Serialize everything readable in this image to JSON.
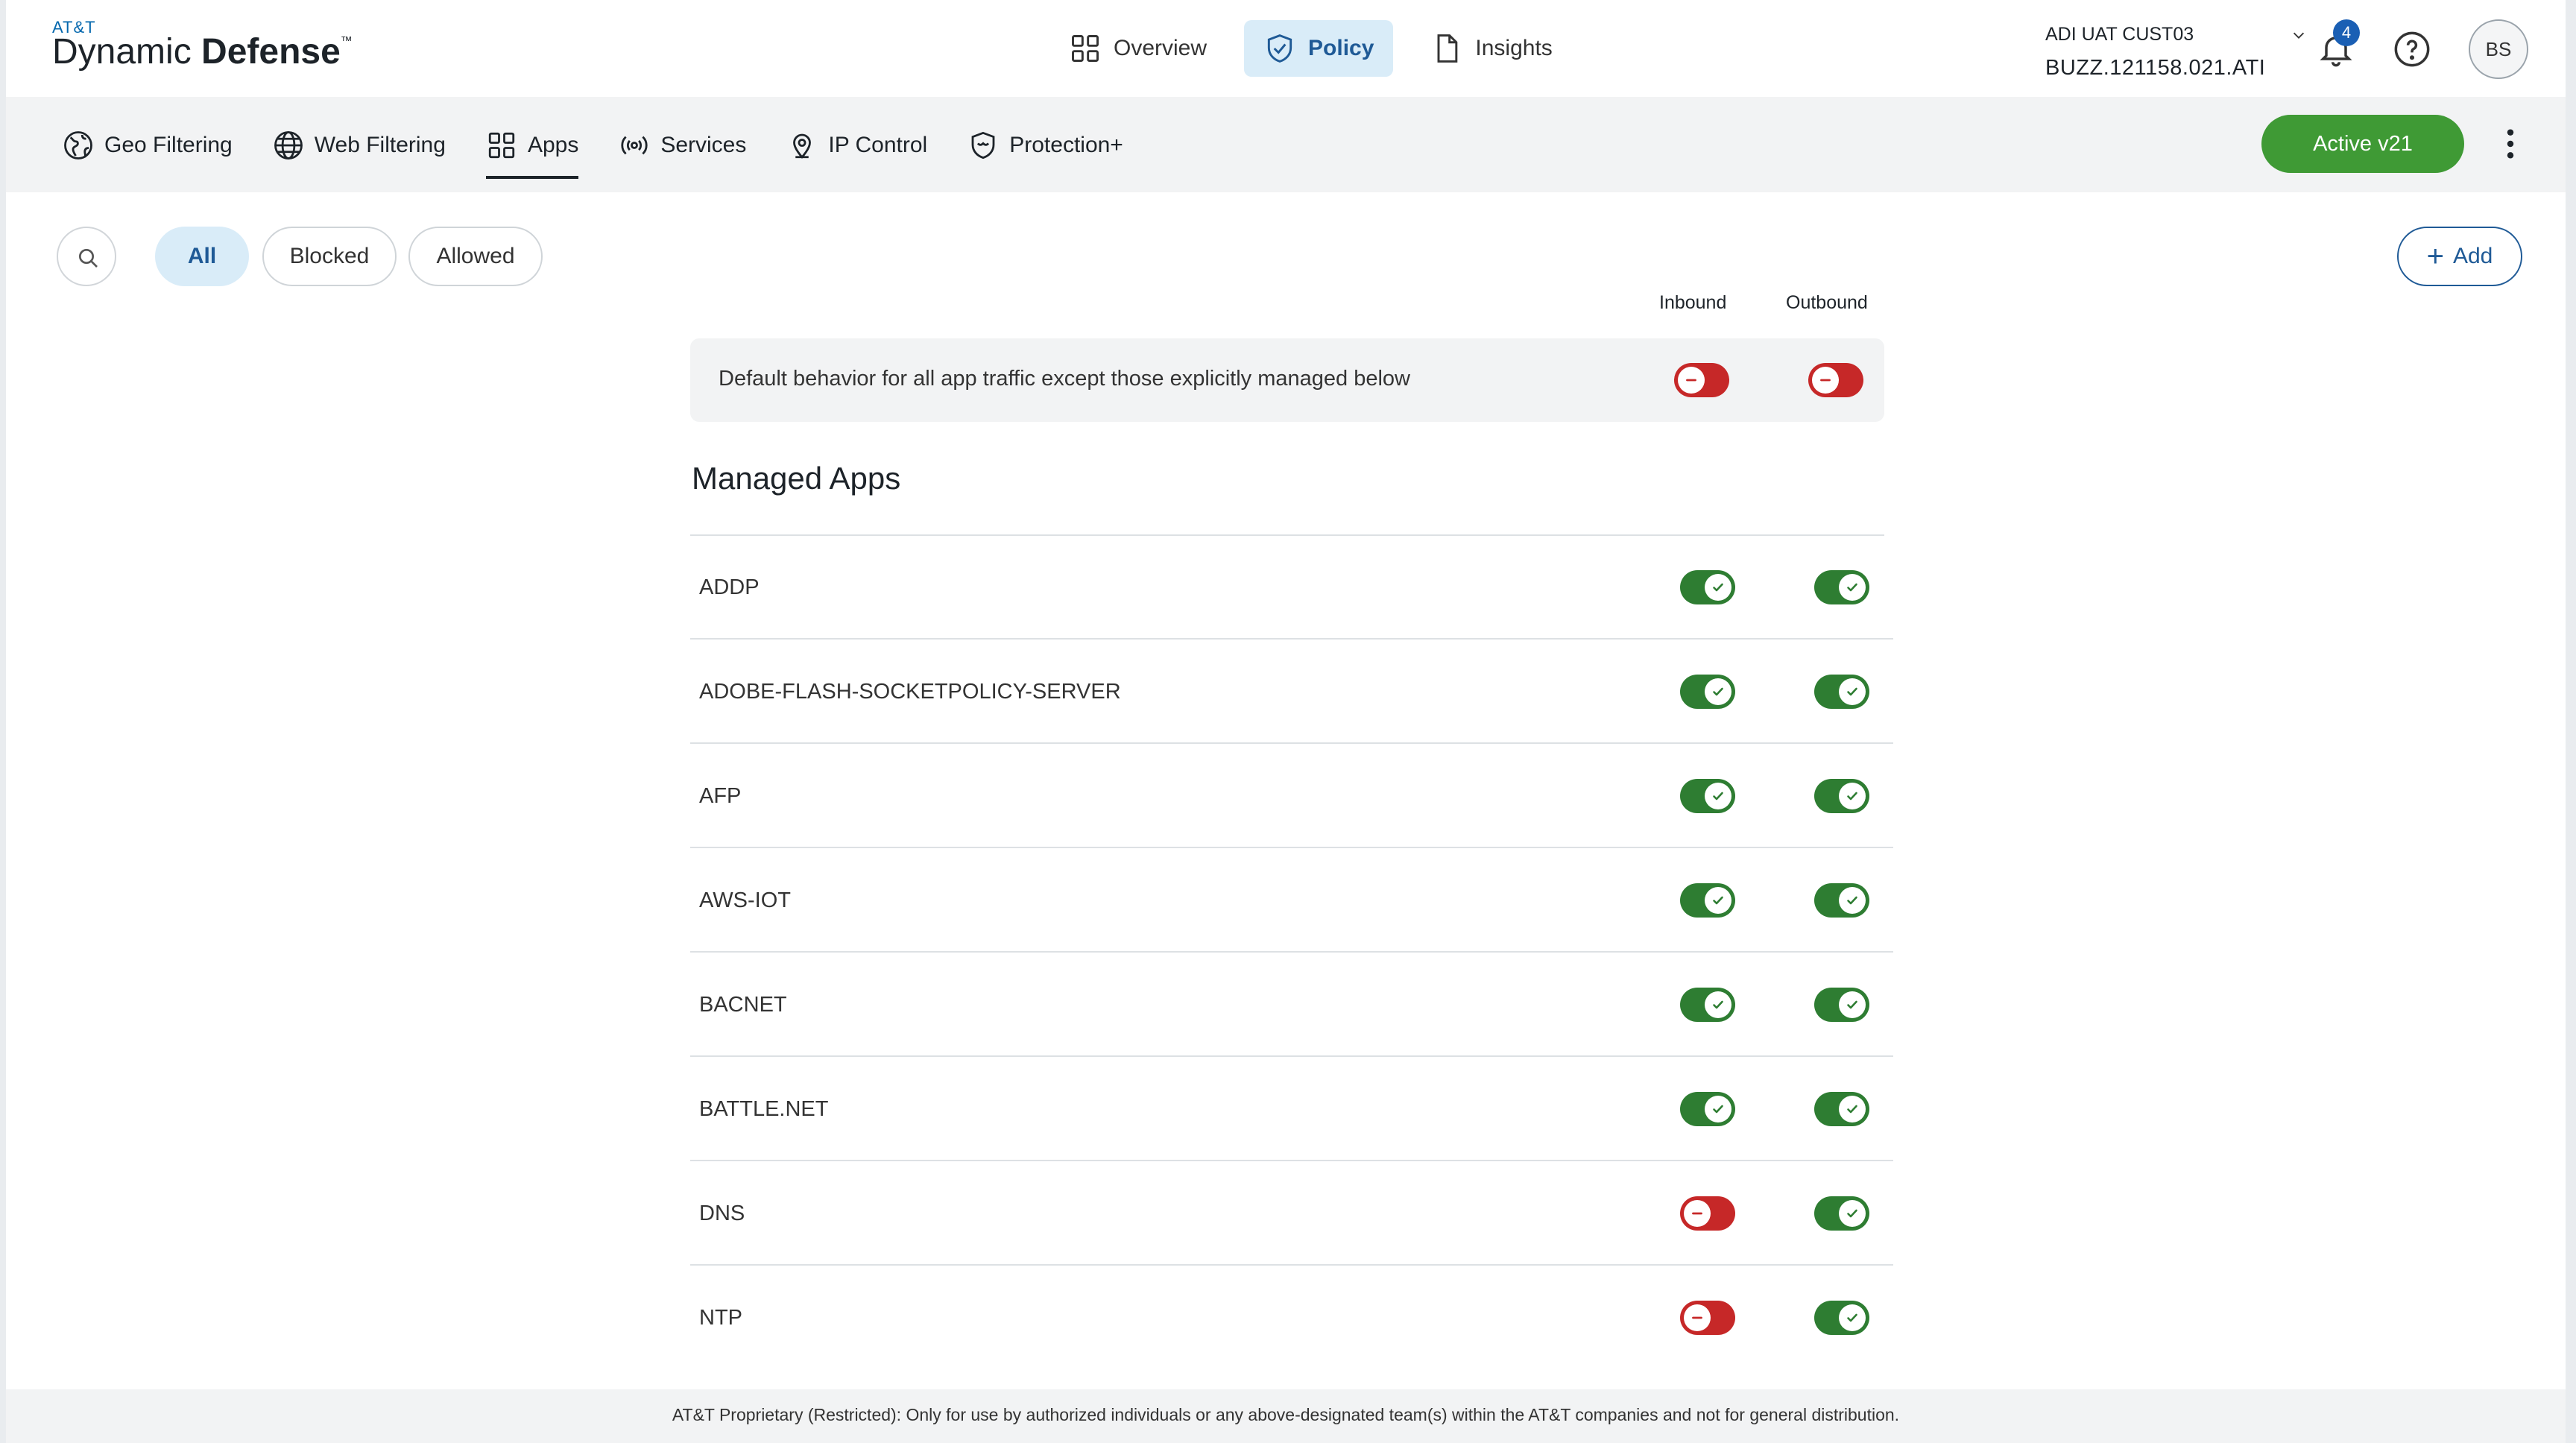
{
  "brand": {
    "company": "AT&T",
    "product_light": "Dynamic ",
    "product_bold": "Defense",
    "trademark": "™"
  },
  "topnav": [
    {
      "label": "Overview",
      "icon": "grid-icon",
      "active": false
    },
    {
      "label": "Policy",
      "icon": "shield-check-icon",
      "active": true
    },
    {
      "label": "Insights",
      "icon": "document-icon",
      "active": false
    }
  ],
  "account": {
    "name": "ADI UAT CUST03",
    "id": "BUZZ.121158.021.ATI"
  },
  "notifications": {
    "count": "4"
  },
  "user": {
    "initials": "BS"
  },
  "subnav": [
    {
      "label": "Geo Filtering",
      "icon": "globe-filled-icon",
      "active": false
    },
    {
      "label": "Web Filtering",
      "icon": "globe-icon",
      "active": false
    },
    {
      "label": "Apps",
      "icon": "apps-grid-icon",
      "active": true
    },
    {
      "label": "Services",
      "icon": "broadcast-icon",
      "active": false
    },
    {
      "label": "IP Control",
      "icon": "location-pin-icon",
      "active": false
    },
    {
      "label": "Protection+",
      "icon": "shield-plus-icon",
      "active": false
    }
  ],
  "policy_status": {
    "label": "Active v21",
    "color": "#3f9a35"
  },
  "filters": {
    "all": "All",
    "blocked": "Blocked",
    "allowed": "Allowed",
    "selected": "All"
  },
  "add_label": "Add",
  "columns": {
    "inbound": "Inbound",
    "outbound": "Outbound"
  },
  "default_behavior": {
    "text": "Default behavior for all app traffic except those explicitly managed below",
    "inbound": false,
    "outbound": false
  },
  "section_title": "Managed Apps",
  "apps": [
    {
      "name": "ADDP",
      "inbound": true,
      "outbound": true
    },
    {
      "name": "ADOBE-FLASH-SOCKETPOLICY-SERVER",
      "inbound": true,
      "outbound": true
    },
    {
      "name": "AFP",
      "inbound": true,
      "outbound": true
    },
    {
      "name": "AWS-IOT",
      "inbound": true,
      "outbound": true
    },
    {
      "name": "BACNET",
      "inbound": true,
      "outbound": true
    },
    {
      "name": "BATTLE.NET",
      "inbound": true,
      "outbound": true
    },
    {
      "name": "DNS",
      "inbound": false,
      "outbound": true
    },
    {
      "name": "NTP",
      "inbound": false,
      "outbound": true
    }
  ],
  "colors": {
    "allowed": "#2e7d32",
    "blocked": "#c62828",
    "accent": "#1f5a96"
  },
  "footer": "AT&T Proprietary (Restricted): Only for use by authorized individuals or any above-designated team(s) within the AT&T companies and not for general distribution."
}
